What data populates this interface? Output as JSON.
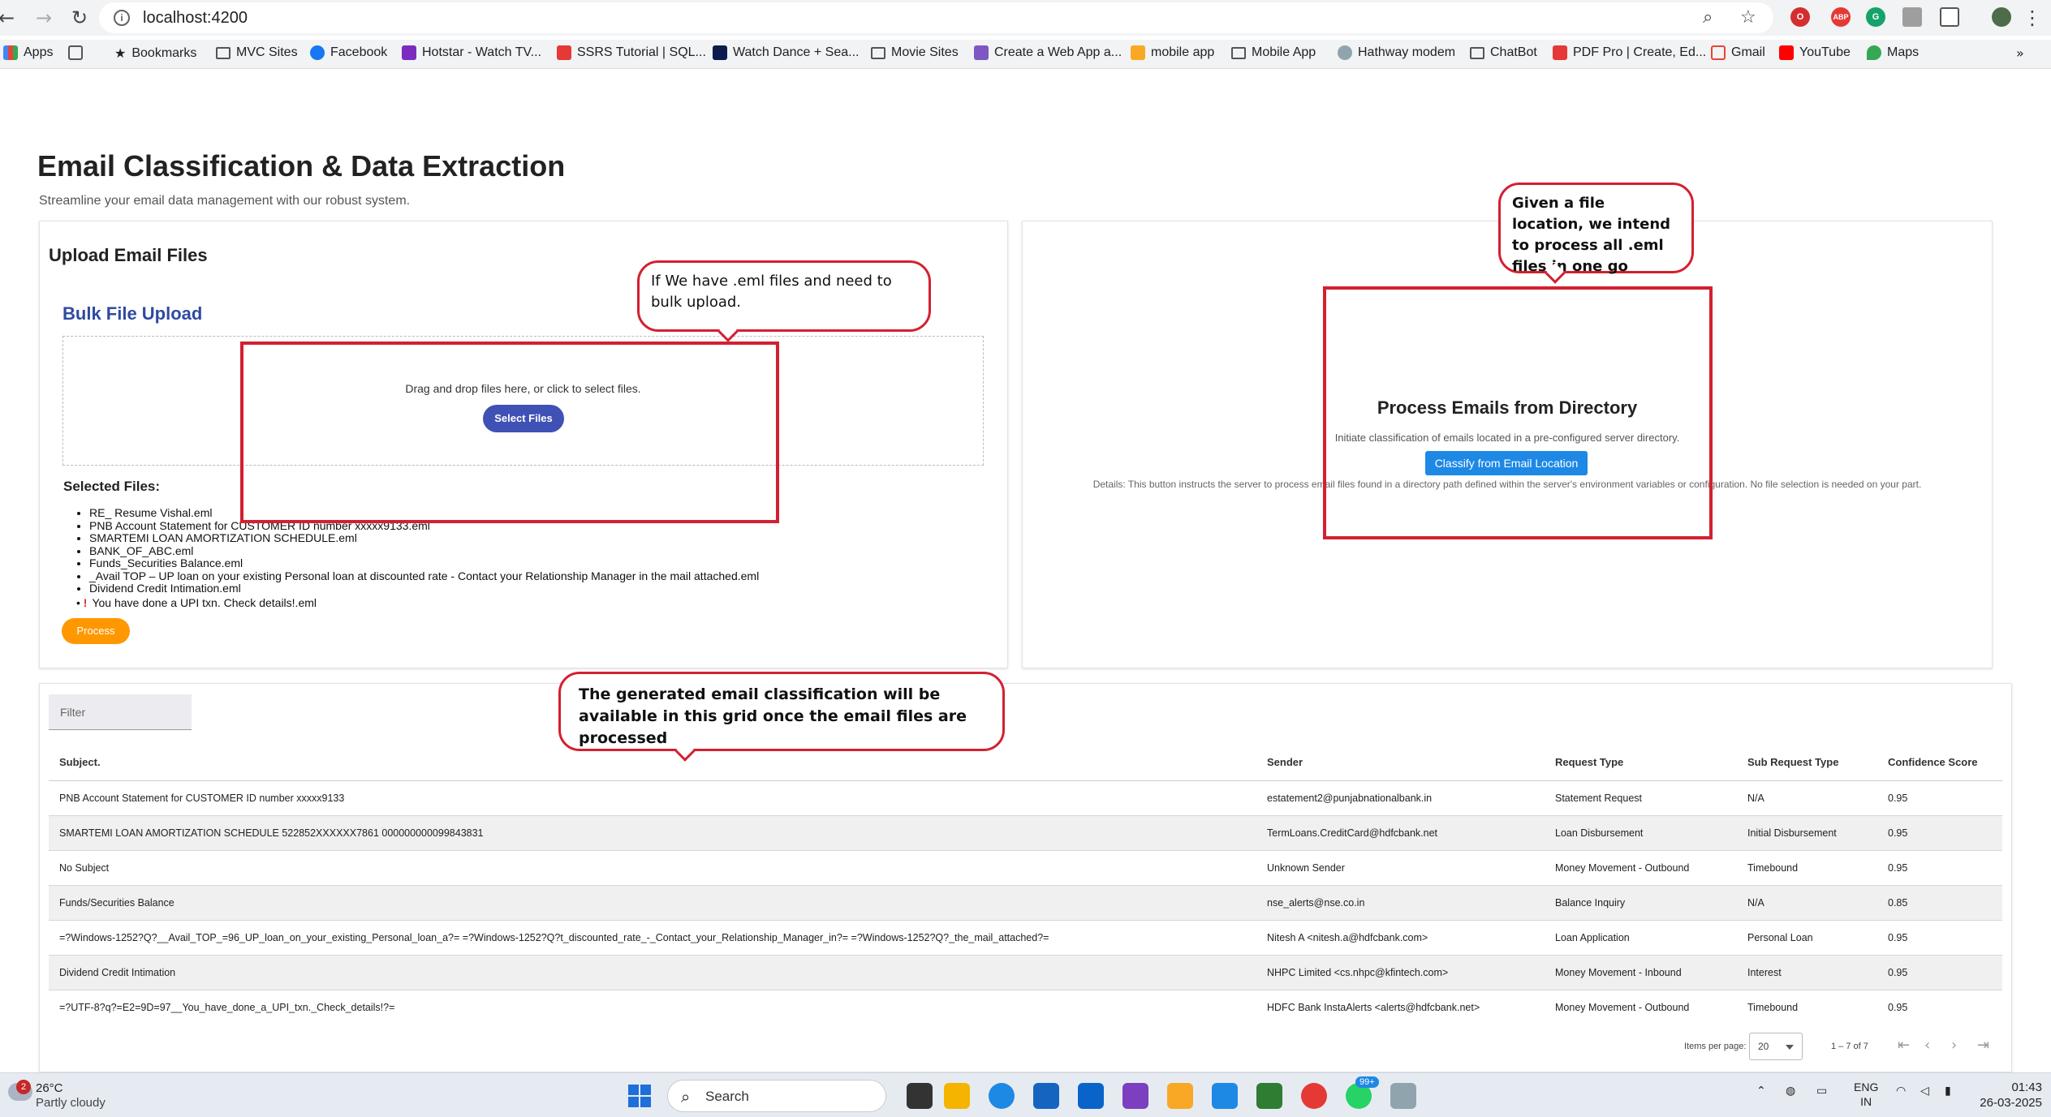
{
  "browser": {
    "url": "localhost:4200",
    "bookmarks": [
      {
        "label": "Apps"
      },
      {
        "label": ""
      },
      {
        "label": "Bookmarks"
      },
      {
        "label": "MVC Sites"
      },
      {
        "label": "Facebook"
      },
      {
        "label": "Hotstar - Watch TV..."
      },
      {
        "label": "SSRS Tutorial | SQL..."
      },
      {
        "label": "Watch Dance + Sea..."
      },
      {
        "label": "Movie Sites"
      },
      {
        "label": "Create a Web App a..."
      },
      {
        "label": "mobile app"
      },
      {
        "label": "Mobile App"
      },
      {
        "label": "Hathway modem"
      },
      {
        "label": "ChatBot"
      },
      {
        "label": "PDF Pro | Create, Ed..."
      },
      {
        "label": "Gmail"
      },
      {
        "label": "YouTube"
      },
      {
        "label": "Maps"
      }
    ]
  },
  "page": {
    "title": "Email Classification & Data Extraction",
    "subtitle": "Streamline your email data management with our robust system."
  },
  "upload": {
    "heading": "Upload Email Files",
    "bulk_title": "Bulk File Upload",
    "drop_text": "Drag and drop files here, or click to select files.",
    "select_button": "Select Files",
    "selected_heading": "Selected Files:",
    "files": [
      "RE_ Resume Vishal.eml",
      "PNB Account Statement for CUSTOMER ID number xxxxx9133.eml",
      "SMARTEMI LOAN AMORTIZATION SCHEDULE.eml",
      "BANK_OF_ABC.eml",
      "Funds_Securities Balance.eml",
      "_Avail TOP – UP loan on your existing Personal loan at discounted rate - Contact your Relationship Manager in the mail attached.eml",
      "Dividend Credit Intimation.eml"
    ],
    "warn_file": "You have done a UPI txn. Check details!.eml",
    "warn_mark": "!",
    "process_button": "Process"
  },
  "directory": {
    "title": "Process Emails from Directory",
    "description": "Initiate classification of emails located in a pre-configured server directory.",
    "button": "Classify from Email Location",
    "details": "Details: This button instructs the server to process email files found in a directory path defined within the server's environment variables or configuration. No file selection is needed on your part."
  },
  "grid": {
    "filter_label": "Filter",
    "headers": {
      "subject": "Subject.",
      "sender": "Sender",
      "request_type": "Request Type",
      "sub_request_type": "Sub Request Type",
      "confidence": "Confidence Score"
    },
    "rows": [
      {
        "subject": "PNB Account Statement for CUSTOMER ID number xxxxx9133",
        "sender": "estatement2@punjabnationalbank.in",
        "request_type": "Statement Request",
        "sub_request_type": "N/A",
        "confidence": "0.95"
      },
      {
        "subject": "SMARTEMI LOAN AMORTIZATION SCHEDULE 522852XXXXXX7861 000000000099843831",
        "sender": "TermLoans.CreditCard@hdfcbank.net",
        "request_type": "Loan Disbursement",
        "sub_request_type": "Initial Disbursement",
        "confidence": "0.95"
      },
      {
        "subject": "No Subject",
        "sender": "Unknown Sender",
        "request_type": "Money Movement - Outbound",
        "sub_request_type": "Timebound",
        "confidence": "0.95"
      },
      {
        "subject": "Funds/Securities Balance",
        "sender": "nse_alerts@nse.co.in",
        "request_type": "Balance Inquiry",
        "sub_request_type": "N/A",
        "confidence": "0.85"
      },
      {
        "subject": "=?Windows-1252?Q?__Avail_TOP_=96_UP_loan_on_your_existing_Personal_loan_a?= =?Windows-1252?Q?t_discounted_rate_-_Contact_your_Relationship_Manager_in?= =?Windows-1252?Q?_the_mail_attached?=",
        "sender": "Nitesh A <nitesh.a@hdfcbank.com>",
        "request_type": "Loan Application",
        "sub_request_type": "Personal Loan",
        "confidence": "0.95"
      },
      {
        "subject": "Dividend Credit Intimation",
        "sender": "NHPC Limited <cs.nhpc@kfintech.com>",
        "request_type": "Money Movement - Inbound",
        "sub_request_type": "Interest",
        "confidence": "0.95"
      },
      {
        "subject": "=?UTF-8?q?=E2=9D=97__You_have_done_a_UPI_txn._Check_details!?=",
        "sender": "HDFC Bank InstaAlerts <alerts@hdfcbank.net>",
        "request_type": "Money Movement - Outbound",
        "sub_request_type": "Timebound",
        "confidence": "0.95"
      }
    ],
    "paginator": {
      "items_per_page_label": "Items per page:",
      "page_size": "20",
      "range": "1 – 7 of 7"
    }
  },
  "annotations": {
    "bulk": "If We have .eml files and need to bulk upload.",
    "directory": "Given a file location, we intend to process all .eml files in one go",
    "grid": "The generated email classification will be available in this grid once the email files are processed"
  },
  "taskbar": {
    "weather_badge": "2",
    "temperature": "26°C",
    "weather": "Partly cloudy",
    "search_label": "Search",
    "notif_badge": "99+",
    "lang_top": "ENG",
    "lang_bottom": "IN",
    "time": "01:43",
    "date": "26-03-2025"
  },
  "colors": {
    "bulk_title": "#2f4aa3",
    "select_button": "#3f51b5",
    "process_button": "#ff9800",
    "classify_button": "#1e88e5",
    "annotation": "#d32030"
  }
}
